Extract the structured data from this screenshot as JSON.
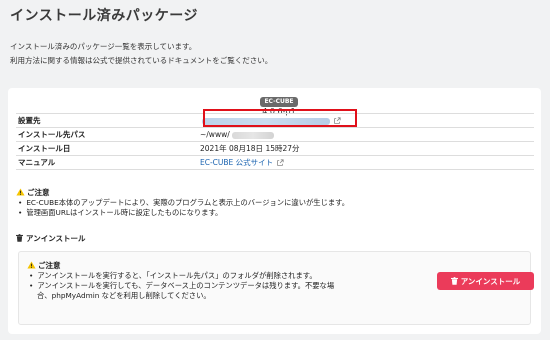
{
  "page": {
    "title": "インストール済みパッケージ",
    "intro_line1": "インストール済みのパッケージ一覧を表示しています。",
    "intro_line2": "利用方法に関する情報は公式で提供されているドキュメントをご覧ください。"
  },
  "package": {
    "badge": "EC-CUBE",
    "version": "4.0.6-p1"
  },
  "info": {
    "location_label": "設置先",
    "install_path_label": "インストール先パス",
    "install_path_value": "~/www/",
    "install_date_label": "インストール日",
    "install_date_value": "2021年 08月18日 15時27分",
    "manual_label": "マニュアル",
    "manual_link": "EC-CUBE 公式サイト"
  },
  "notice": {
    "title": "ご注意",
    "items": [
      "EC-CUBE本体のアップデートにより、実際のプログラムと表示上のバージョンに違いが生じます。",
      "管理画面URLはインストール時に設定したものになります。"
    ]
  },
  "uninstall": {
    "section_title": "アンインストール",
    "notice_title": "ご注意",
    "items": [
      "アンインストールを実行すると、「インストール先パス」のフォルダが削除されます。",
      "アンインストールを実行しても、データベース上のコンテンツデータは残ります。不要な場",
      "合、phpMyAdmin などを利用し削除してください。"
    ],
    "button_label": "アンインストール"
  },
  "colors": {
    "accent_red": "#eb3b5a",
    "link_blue": "#1a63b0",
    "warning_yellow": "#f5c400",
    "highlight_red": "#e0101a"
  },
  "icons": [
    "warning-icon",
    "trash-icon",
    "external-link-icon"
  ]
}
